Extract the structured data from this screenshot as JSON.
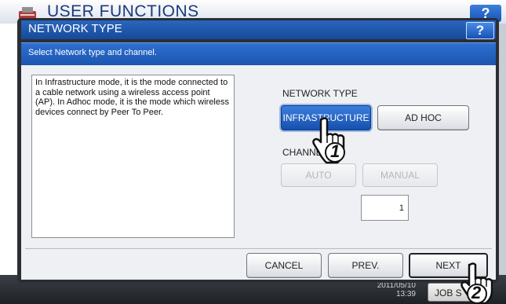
{
  "background": {
    "title": "USER FUNCTIONS",
    "help_label": "?",
    "clock_date": "2011/05/10",
    "clock_time": "13:39",
    "jobs_label": "JOB S"
  },
  "dialog": {
    "title": "NETWORK TYPE",
    "help_label": "?",
    "instruction": "Select Network type and channel.",
    "description": "In Infrastructure mode, it is the mode connected to a cable network using a wireless access point (AP). In Adhoc mode, it is the mode which wireless devices connect by Peer To Peer.",
    "network_type": {
      "label": "NETWORK TYPE",
      "options": [
        "INFRASTRUCTURE",
        "AD HOC"
      ],
      "selected": "INFRASTRUCTURE"
    },
    "channel": {
      "label": "CHANNEL",
      "options": [
        "AUTO",
        "MANUAL"
      ],
      "value": "1"
    },
    "buttons": {
      "cancel": "CANCEL",
      "prev": "PREV.",
      "next": "NEXT"
    }
  },
  "callouts": {
    "step1": "1",
    "step2": "2"
  },
  "colors": {
    "title_bar": "#1c55aa",
    "selected_button": "#1f5fc4",
    "dialog_frame": "#2b2e33"
  }
}
